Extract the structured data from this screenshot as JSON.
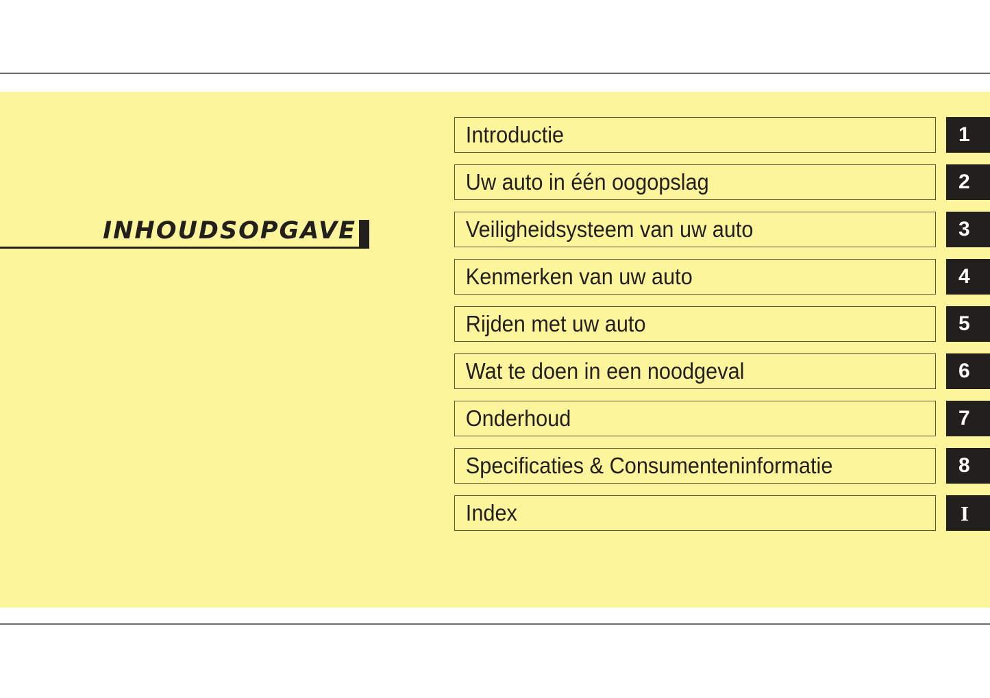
{
  "page": {
    "background_color": "#ffffff",
    "panel_color": "#fdf59c",
    "ink_color": "#231f1c",
    "rule_color": "#6b6b6b"
  },
  "heading": {
    "title": "INHOUDSOPGAVE"
  },
  "contents": {
    "items": [
      {
        "label": "Introductie",
        "tab": "1"
      },
      {
        "label": "Uw auto in één oogopslag",
        "tab": "2"
      },
      {
        "label": "Veiligheidsysteem van uw auto",
        "tab": "3"
      },
      {
        "label": "Kenmerken van uw auto",
        "tab": "4"
      },
      {
        "label": "Rijden met uw auto",
        "tab": "5"
      },
      {
        "label": "Wat te doen in een noodgeval",
        "tab": "6"
      },
      {
        "label": "Onderhoud",
        "tab": "7"
      },
      {
        "label": "Specificaties & Consumenteninformatie",
        "tab": "8"
      },
      {
        "label": "Index",
        "tab": "I"
      }
    ]
  }
}
